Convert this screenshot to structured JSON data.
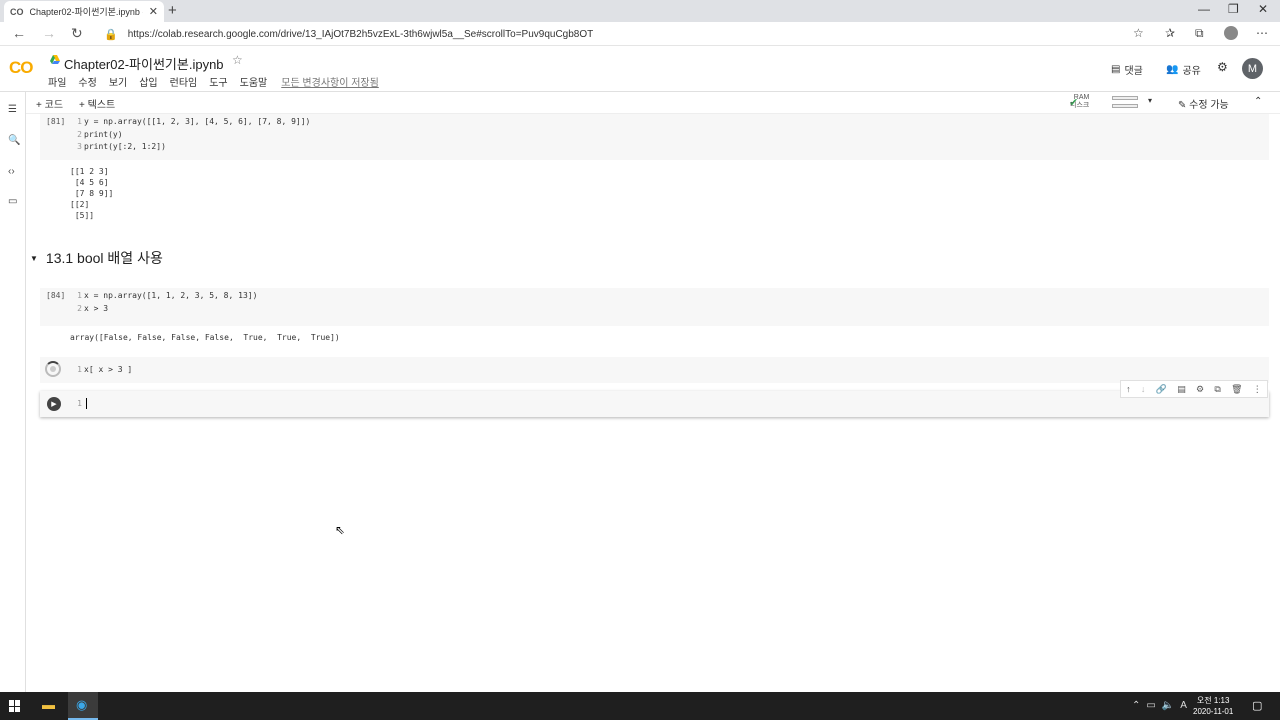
{
  "browser": {
    "tab_title": "Chapter02-파이썬기본.ipynb - C",
    "tab_favicon": "CO",
    "url": "https://colab.research.google.com/drive/13_IAjOt7B2h5vzExL-3th6wjwl5a__Se#scrollTo=Puv9quCgb8OT"
  },
  "colab": {
    "logo": "CO",
    "notebook_title": "Chapter02-파이썬기본.ipynb",
    "menu": [
      "파일",
      "수정",
      "보기",
      "삽입",
      "런타임",
      "도구",
      "도움말"
    ],
    "saved_status": "모든 변경사항이 저장됨",
    "comment_label": "댓글",
    "share_label": "공유",
    "account_initial": "M",
    "toolbar": {
      "add_code": "+ 코드",
      "add_text": "+ 텍스트",
      "ram_label": "RAM",
      "disk_label": "디스크",
      "edit_label": "수정 가능"
    }
  },
  "cells": {
    "c81": {
      "exec": "[81]",
      "line1": "y = np.array([[1, 2, 3], [4, 5, 6], [7, 8, 9]])",
      "line2": "print(y)",
      "line3": "print(y[:2, 1:2])",
      "output": "[[1 2 3]\n [4 5 6]\n [7 8 9]]\n[[2]\n [5]]"
    },
    "heading": "13.1 bool 배열 사용",
    "c84": {
      "exec": "[84]",
      "line1": "x = np.array([1, 1, 2, 3, 5, 8, 13])",
      "line2": "x > 3",
      "output": "array([False, False, False, False,  True,  True,  True])"
    },
    "running": {
      "line1": "x[ x > 3 ]"
    },
    "empty": {
      "line_no": "1"
    }
  },
  "taskbar": {
    "time": "오전 1:13",
    "date": "2020-11-01",
    "ime": "A"
  }
}
